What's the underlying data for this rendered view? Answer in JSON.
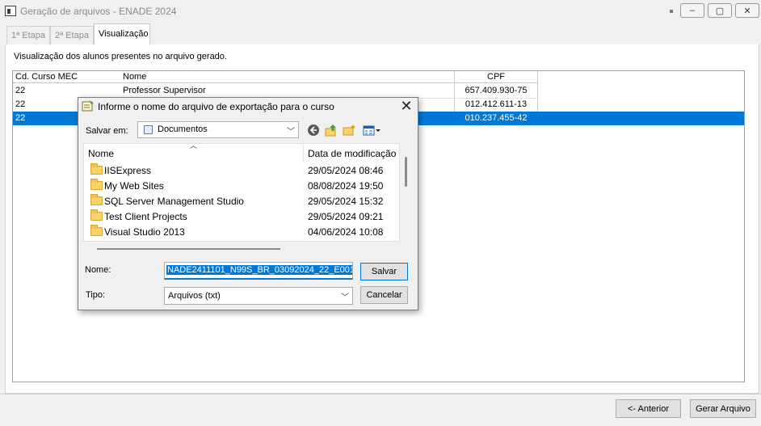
{
  "window": {
    "title": "Geração de arquivos - ENADE 2024",
    "buttons": [
      "–",
      "▢",
      "✕"
    ]
  },
  "tabs": [
    {
      "label": "1ª Etapa",
      "active": false
    },
    {
      "label": "2ª Etapa",
      "active": false
    },
    {
      "label": "Visualização",
      "active": true
    }
  ],
  "panel": {
    "description": "Visualização dos alunos presentes no arquivo gerado.",
    "columns": [
      "Cd. Curso MEC",
      "Nome",
      "CPF"
    ],
    "rows": [
      {
        "code": "22",
        "name": "Professor Supervisor",
        "cpf": "657.409.930-75",
        "selected": false
      },
      {
        "code": "22",
        "name": "",
        "cpf": "012.412.611-13",
        "selected": false
      },
      {
        "code": "22",
        "name": "",
        "cpf": "010.237.455-42",
        "selected": true
      }
    ]
  },
  "footer": {
    "back_label": "<- Anterior",
    "generate_label": "Gerar Arquivo"
  },
  "dialog": {
    "title": "Informe o nome do arquivo de exportação para o curso",
    "save_in_label": "Salvar em:",
    "save_in_value": "Documentos",
    "list_headers": {
      "name": "Nome",
      "date": "Data de modificação"
    },
    "files": [
      {
        "name": "IISExpress",
        "date": "29/05/2024 08:46"
      },
      {
        "name": "My Web Sites",
        "date": "08/08/2024 19:50"
      },
      {
        "name": "SQL Server Management Studio",
        "date": "29/05/2024 15:32"
      },
      {
        "name": "Test Client Projects",
        "date": "29/05/2024 09:21"
      },
      {
        "name": "Visual Studio 2013",
        "date": "04/06/2024 10:08"
      }
    ],
    "name_label": "Nome:",
    "name_value": "NADE2411101_N99S_BR_03092024_22_E001",
    "type_label": "Tipo:",
    "type_value": "Arquivos (txt)",
    "save_label": "Salvar",
    "cancel_label": "Cancelar"
  },
  "colors": {
    "selection": "#0078d7",
    "folder": "#f8d36a"
  }
}
